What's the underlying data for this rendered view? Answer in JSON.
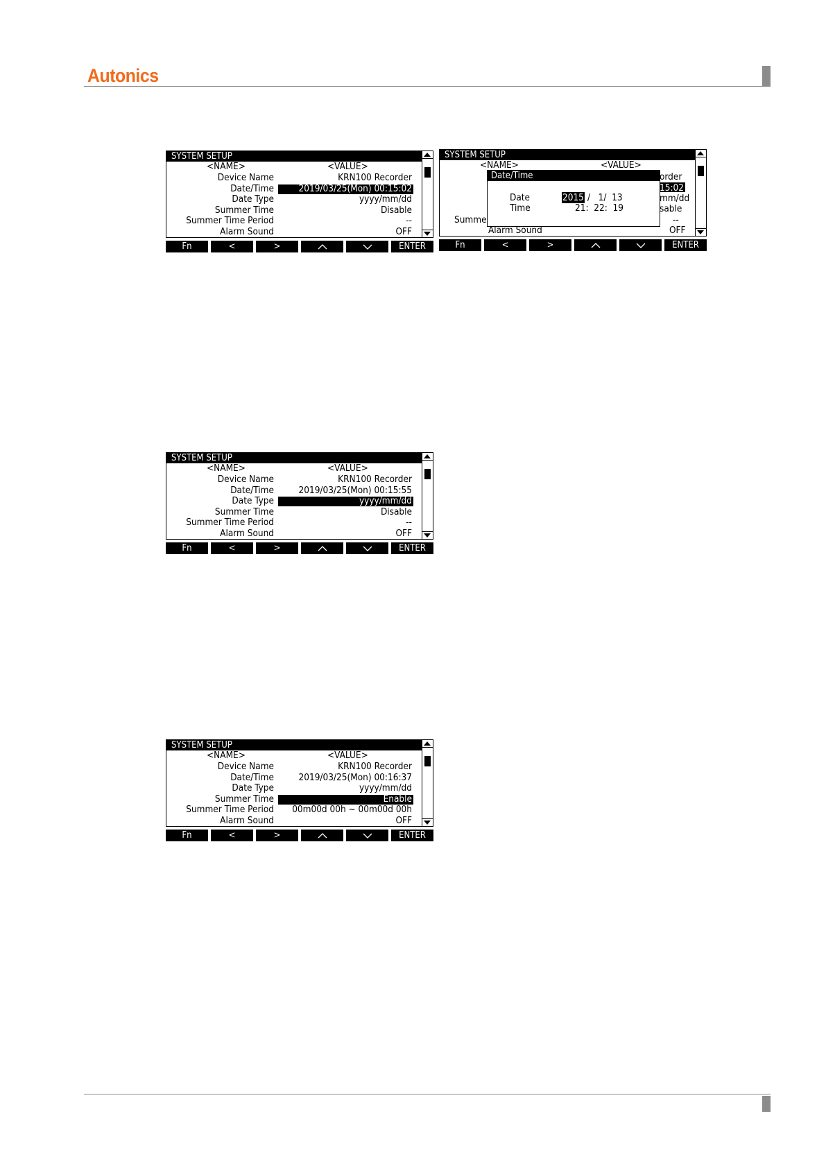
{
  "brand": {
    "logo_text": "Autonics"
  },
  "screen1": {
    "title": "SYSTEM SETUP",
    "header_name": "<NAME>",
    "header_value": "<VALUE>",
    "rows": [
      {
        "name": "Device Name",
        "value": "KRN100 Recorder"
      },
      {
        "name": "Date/Time",
        "value": "2019/03/25(Mon) 00:15:02"
      },
      {
        "name": "Date Type",
        "value": "yyyy/mm/dd"
      },
      {
        "name": "Summer Time",
        "value": "Disable"
      },
      {
        "name": "Summer Time Period",
        "value": "--"
      },
      {
        "name": "Alarm Sound",
        "value": "OFF"
      }
    ],
    "fkeys": [
      "Fn",
      "<",
      ">",
      "^",
      "v",
      "ENTER"
    ]
  },
  "screen2": {
    "title": "SYSTEM SETUP",
    "header_name": "<NAME>",
    "header_value": "<VALUE>",
    "row_tails": [
      "order",
      "15:02",
      "mm/dd",
      "sable",
      "--",
      "OFF"
    ],
    "summer_partial": "Summer",
    "alarm_partial": "Alarm Sound",
    "popup": {
      "title": "Date/Time",
      "date_label": "Date",
      "time_label": "Time",
      "year": "2015",
      "date_rest": "/   1/  13",
      "time_value": "21:  22:  19"
    },
    "fkeys": [
      "Fn",
      "<",
      ">",
      "^",
      "v",
      "ENTER"
    ]
  },
  "screen3": {
    "title": "SYSTEM SETUP",
    "header_name": "<NAME>",
    "header_value": "<VALUE>",
    "rows": [
      {
        "name": "Device Name",
        "value": "KRN100 Recorder"
      },
      {
        "name": "Date/Time",
        "value": "2019/03/25(Mon) 00:15:55"
      },
      {
        "name": "Date Type",
        "value": "yyyy/mm/dd"
      },
      {
        "name": "Summer Time",
        "value": "Disable"
      },
      {
        "name": "Summer Time Period",
        "value": "--"
      },
      {
        "name": "Alarm Sound",
        "value": "OFF"
      }
    ],
    "fkeys": [
      "Fn",
      "<",
      ">",
      "^",
      "v",
      "ENTER"
    ]
  },
  "screen4": {
    "title": "SYSTEM SETUP",
    "header_name": "<NAME>",
    "header_value": "<VALUE>",
    "rows": [
      {
        "name": "Device Name",
        "value": "KRN100 Recorder"
      },
      {
        "name": "Date/Time",
        "value": "2019/03/25(Mon) 00:16:37"
      },
      {
        "name": "Date Type",
        "value": "yyyy/mm/dd"
      },
      {
        "name": "Summer Time",
        "value": "Enable"
      },
      {
        "name": "Summer Time Period",
        "value": "00m00d 00h ~ 00m00d 00h"
      },
      {
        "name": "Alarm Sound",
        "value": "OFF"
      }
    ],
    "fkeys": [
      "Fn",
      "<",
      ">",
      "^",
      "v",
      "ENTER"
    ]
  }
}
